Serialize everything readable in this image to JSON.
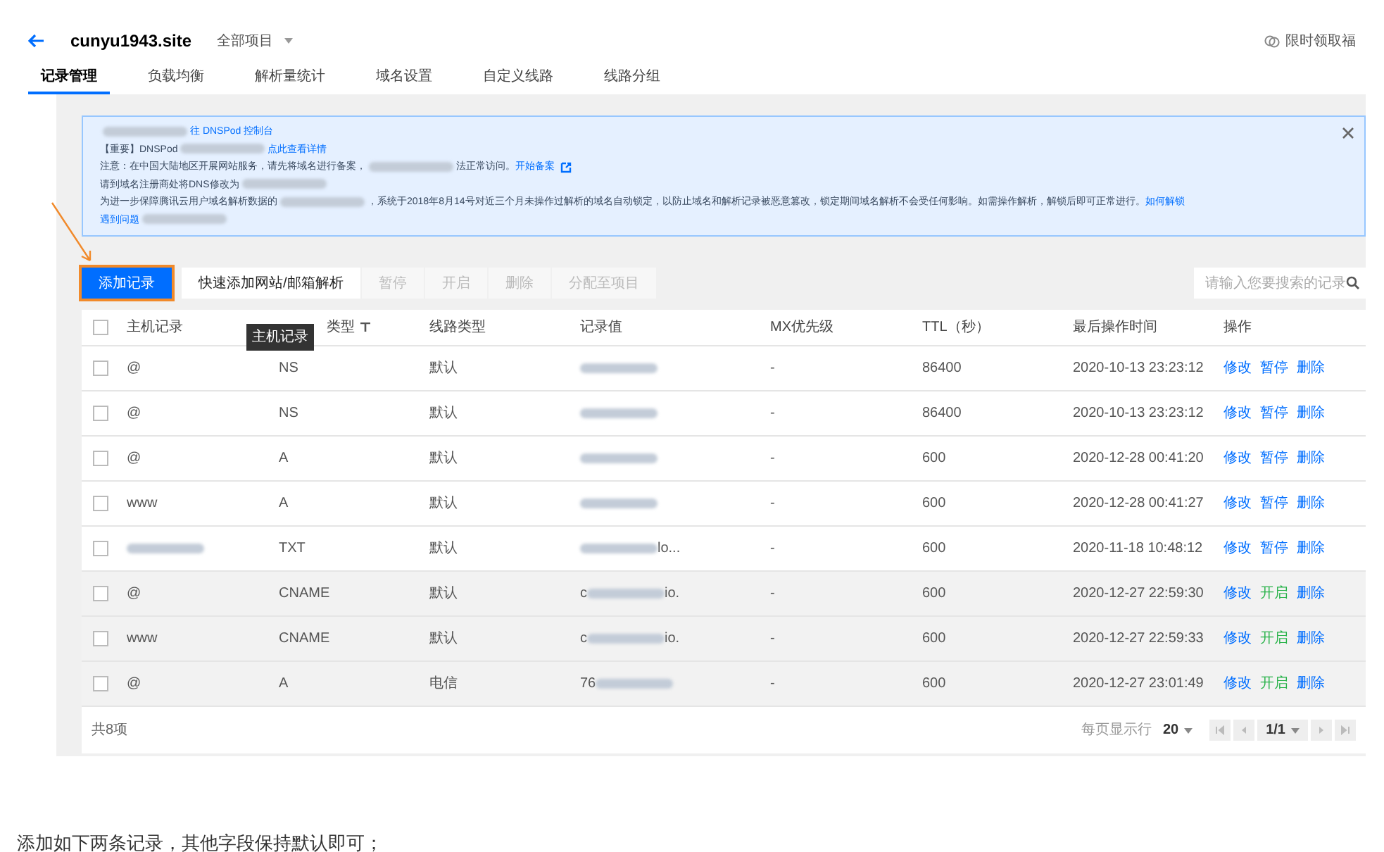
{
  "header": {
    "domain": "cunyu1943.site",
    "project": "全部项目",
    "promo": "限时领取福"
  },
  "tabs": [
    {
      "label": "记录管理",
      "selected": true
    },
    {
      "label": "负载均衡",
      "selected": false
    },
    {
      "label": "解析量统计",
      "selected": false
    },
    {
      "label": "域名设置",
      "selected": false
    },
    {
      "label": "自定义线路",
      "selected": false
    },
    {
      "label": "线路分组",
      "selected": false
    }
  ],
  "notice": {
    "lines": [
      [
        {
          "kind": "redacted"
        },
        {
          "kind": "link",
          "text": "往 DNSPod 控制台"
        }
      ],
      [
        {
          "kind": "text",
          "text": "【重要】DNSPod"
        },
        {
          "kind": "redacted"
        },
        {
          "kind": "link",
          "text": "点此查看详情"
        }
      ],
      [
        {
          "kind": "text",
          "text": "注意：在中国大陆地区开展网站服务，请先将域名进行备案，"
        },
        {
          "kind": "redacted"
        },
        {
          "kind": "text",
          "text": "法正常访问。"
        },
        {
          "kind": "extlink",
          "text": "开始备案"
        }
      ],
      [
        {
          "kind": "text",
          "text": "请到域名注册商处将DNS修改为"
        },
        {
          "kind": "redacted"
        }
      ],
      [
        {
          "kind": "text",
          "text": "为进一步保障腾讯云用户域名解析数据的"
        },
        {
          "kind": "redacted"
        },
        {
          "kind": "text",
          "text": "，系统于2018年8月14号对近三个月未操作过解析的域名自动锁定，以防止域名和解析记录被恶意篡改，锁定期间域名解析不会受任何影响。如需操作解析，解锁后即可正常进行。"
        },
        {
          "kind": "link",
          "text": "如何解锁"
        }
      ],
      [
        {
          "kind": "link",
          "text": "遇到问题"
        },
        {
          "kind": "redacted"
        }
      ]
    ]
  },
  "toolbar": {
    "buttons": [
      {
        "label": "添加记录",
        "kind": "primary",
        "disabled": false,
        "highlighted": true
      },
      {
        "label": "快速添加网站/邮箱解析",
        "kind": "default",
        "disabled": false,
        "highlighted": false
      },
      {
        "label": "暂停",
        "kind": "default",
        "disabled": true,
        "highlighted": false
      },
      {
        "label": "开启",
        "kind": "default",
        "disabled": true,
        "highlighted": false
      },
      {
        "label": "删除",
        "kind": "default",
        "disabled": true,
        "highlighted": false
      },
      {
        "label": "分配至项目",
        "kind": "default",
        "disabled": true,
        "highlighted": false
      }
    ],
    "search": {
      "placeholder": "请输入您要搜索的记录"
    }
  },
  "table": {
    "columns": [
      "主机记录",
      "类型",
      "线路类型",
      "记录值",
      "MX优先级",
      "TTL（秒）",
      "最后操作时间",
      "操作"
    ],
    "tooltip": "主机记录",
    "all_checked": false,
    "rows": [
      {
        "host": [
          {
            "kind": "text",
            "text": "@"
          }
        ],
        "type": "NS",
        "line": "默认",
        "value": [
          {
            "kind": "redacted"
          }
        ],
        "mx": "-",
        "ttl": "86400",
        "time": "2020-10-13 23:23:12",
        "paused": false,
        "checked": false,
        "actions": [
          "修改",
          "暂停",
          "删除"
        ]
      },
      {
        "host": [
          {
            "kind": "text",
            "text": "@"
          }
        ],
        "type": "NS",
        "line": "默认",
        "value": [
          {
            "kind": "redacted"
          }
        ],
        "mx": "-",
        "ttl": "86400",
        "time": "2020-10-13 23:23:12",
        "paused": false,
        "checked": false,
        "actions": [
          "修改",
          "暂停",
          "删除"
        ]
      },
      {
        "host": [
          {
            "kind": "text",
            "text": "@"
          }
        ],
        "type": "A",
        "line": "默认",
        "value": [
          {
            "kind": "redacted"
          }
        ],
        "mx": "-",
        "ttl": "600",
        "time": "2020-12-28 00:41:20",
        "paused": false,
        "checked": false,
        "actions": [
          "修改",
          "暂停",
          "删除"
        ]
      },
      {
        "host": [
          {
            "kind": "text",
            "text": "www"
          }
        ],
        "type": "A",
        "line": "默认",
        "value": [
          {
            "kind": "redacted"
          }
        ],
        "mx": "-",
        "ttl": "600",
        "time": "2020-12-28 00:41:27",
        "paused": false,
        "checked": false,
        "actions": [
          "修改",
          "暂停",
          "删除"
        ]
      },
      {
        "host": [
          {
            "kind": "redacted"
          }
        ],
        "type": "TXT",
        "line": "默认",
        "value": [
          {
            "kind": "redacted"
          },
          {
            "kind": "text",
            "text": "lo..."
          }
        ],
        "mx": "-",
        "ttl": "600",
        "time": "2020-11-18 10:48:12",
        "paused": false,
        "checked": false,
        "actions": [
          "修改",
          "暂停",
          "删除"
        ]
      },
      {
        "host": [
          {
            "kind": "text",
            "text": "@"
          }
        ],
        "type": "CNAME",
        "line": "默认",
        "value": [
          {
            "kind": "text",
            "text": "c"
          },
          {
            "kind": "redacted"
          },
          {
            "kind": "text",
            "text": "io."
          }
        ],
        "mx": "-",
        "ttl": "600",
        "time": "2020-12-27 22:59:30",
        "paused": true,
        "checked": false,
        "actions": [
          "修改",
          "开启",
          "删除"
        ]
      },
      {
        "host": [
          {
            "kind": "text",
            "text": "www"
          }
        ],
        "type": "CNAME",
        "line": "默认",
        "value": [
          {
            "kind": "text",
            "text": "c"
          },
          {
            "kind": "redacted"
          },
          {
            "kind": "text",
            "text": "io."
          }
        ],
        "mx": "-",
        "ttl": "600",
        "time": "2020-12-27 22:59:33",
        "paused": true,
        "checked": false,
        "actions": [
          "修改",
          "开启",
          "删除"
        ]
      },
      {
        "host": [
          {
            "kind": "text",
            "text": "@"
          }
        ],
        "type": "A",
        "line": "电信",
        "value": [
          {
            "kind": "text",
            "text": "76"
          },
          {
            "kind": "redacted"
          }
        ],
        "mx": "-",
        "ttl": "600",
        "time": "2020-12-27 23:01:49",
        "paused": true,
        "checked": false,
        "actions": [
          "修改",
          "开启",
          "删除"
        ]
      }
    ]
  },
  "footer": {
    "total": "共8项",
    "page_size_label": "每页显示行",
    "page_size": "20",
    "page": "1/1"
  },
  "caption": "添加如下两条记录，其他字段保持默认即可；"
}
